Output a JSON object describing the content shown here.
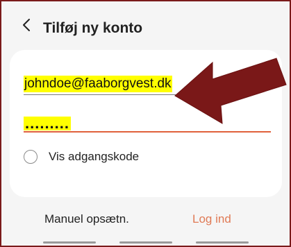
{
  "header": {
    "title": "Tilføj ny konto"
  },
  "form": {
    "email": "johndoe@faaborgvest.dk",
    "password_masked": ".........",
    "show_password_label": "Vis adgangskode",
    "show_password_checked": false
  },
  "footer": {
    "manual_setup_label": "Manuel opsætn.",
    "login_label": "Log ind"
  },
  "colors": {
    "frame_border": "#7a1a1a",
    "highlight": "#ffff00",
    "accent": "#e0603a",
    "arrow": "#7a1818"
  },
  "icons": {
    "back": "chevron-left-icon",
    "annotation": "arrow-annotation-icon"
  }
}
